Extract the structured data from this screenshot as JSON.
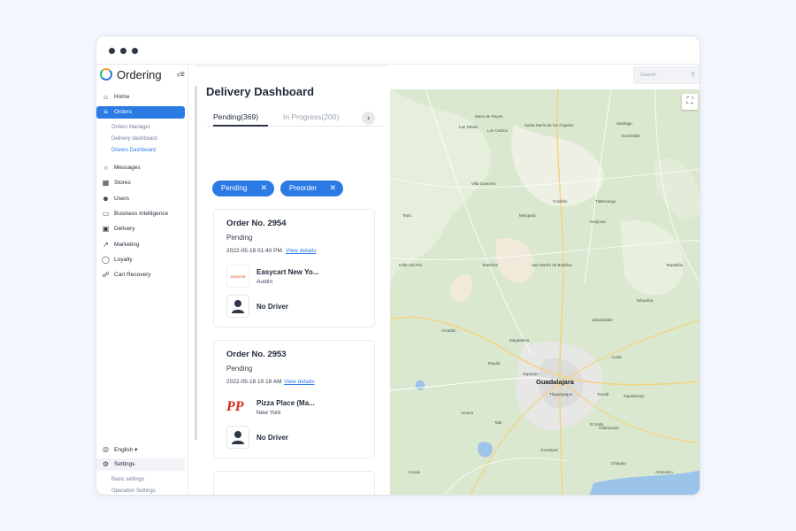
{
  "app": {
    "name": "Ordering"
  },
  "nav": {
    "home": "Home",
    "orders": "Orders",
    "orders_sub": [
      "Orders Manager",
      "Delivery dashboard",
      "Drivers Dashboard"
    ],
    "messages": "Messages",
    "stores": "Stores",
    "users": "Users",
    "business_intelligence": "Business Intelligence",
    "delivery": "Delivery",
    "marketing": "Marketing",
    "loyalty": "Loyalty",
    "cart_recovery": "Cart Recovery",
    "language": "English",
    "settings": "Settings",
    "settings_sub": [
      "Basic settings",
      "Operation Settings"
    ]
  },
  "search": {
    "placeholder": "Search"
  },
  "page": {
    "title": "Delivery Dashboard"
  },
  "tabs": [
    "Pending(369)",
    "In Progress(200)",
    "C"
  ],
  "filters": [
    "Pending",
    "Preorder"
  ],
  "orders": [
    {
      "number": "Order No. 2954",
      "status": "Pending",
      "datetime": "2022-05-18 01:40 PM",
      "view_link": "View details",
      "business": "Easycart New Yo...",
      "business_logo_text": "easycart",
      "city": "Austin",
      "driver": "No Driver"
    },
    {
      "number": "Order No. 2953",
      "status": "Pending",
      "datetime": "2022-05-18 10:18 AM",
      "view_link": "View details",
      "business": "Pizza Place (Ma...",
      "business_logo_text": "PP",
      "city": "New York",
      "driver": "No Driver"
    }
  ],
  "map": {
    "main_city": "Guadalajara",
    "labels": [
      "Mesa de Reyes",
      "Las Tablas",
      "Los Cedros",
      "Santa María de los Ángeles",
      "Santiago",
      "Nochistlán",
      "Villa Guerrero",
      "Colotlán",
      "Tlaltenango",
      "Mezquitic",
      "San Martín de Bolaños",
      "Totatiche",
      "Huejúcar",
      "Tepic",
      "Amatlán",
      "Ixtlán del Río",
      "Magdalena",
      "Tequila",
      "Ameca",
      "Cocula",
      "Tala",
      "Zapopan",
      "Tonalá",
      "Tlaquepaque",
      "Chapala",
      "Jalostotitlán",
      "Yahualica",
      "Ixtlahuacán",
      "Acatic",
      "Zapotlanejo",
      "Tepatitlán",
      "Jocotepec",
      "El Salto",
      "Atotonilco"
    ],
    "fullscreen_icon": "fullscreen-icon"
  },
  "colors": {
    "accent": "#2c7be5",
    "map_bg": "#d9e8cf",
    "water": "#9cc3e8"
  }
}
